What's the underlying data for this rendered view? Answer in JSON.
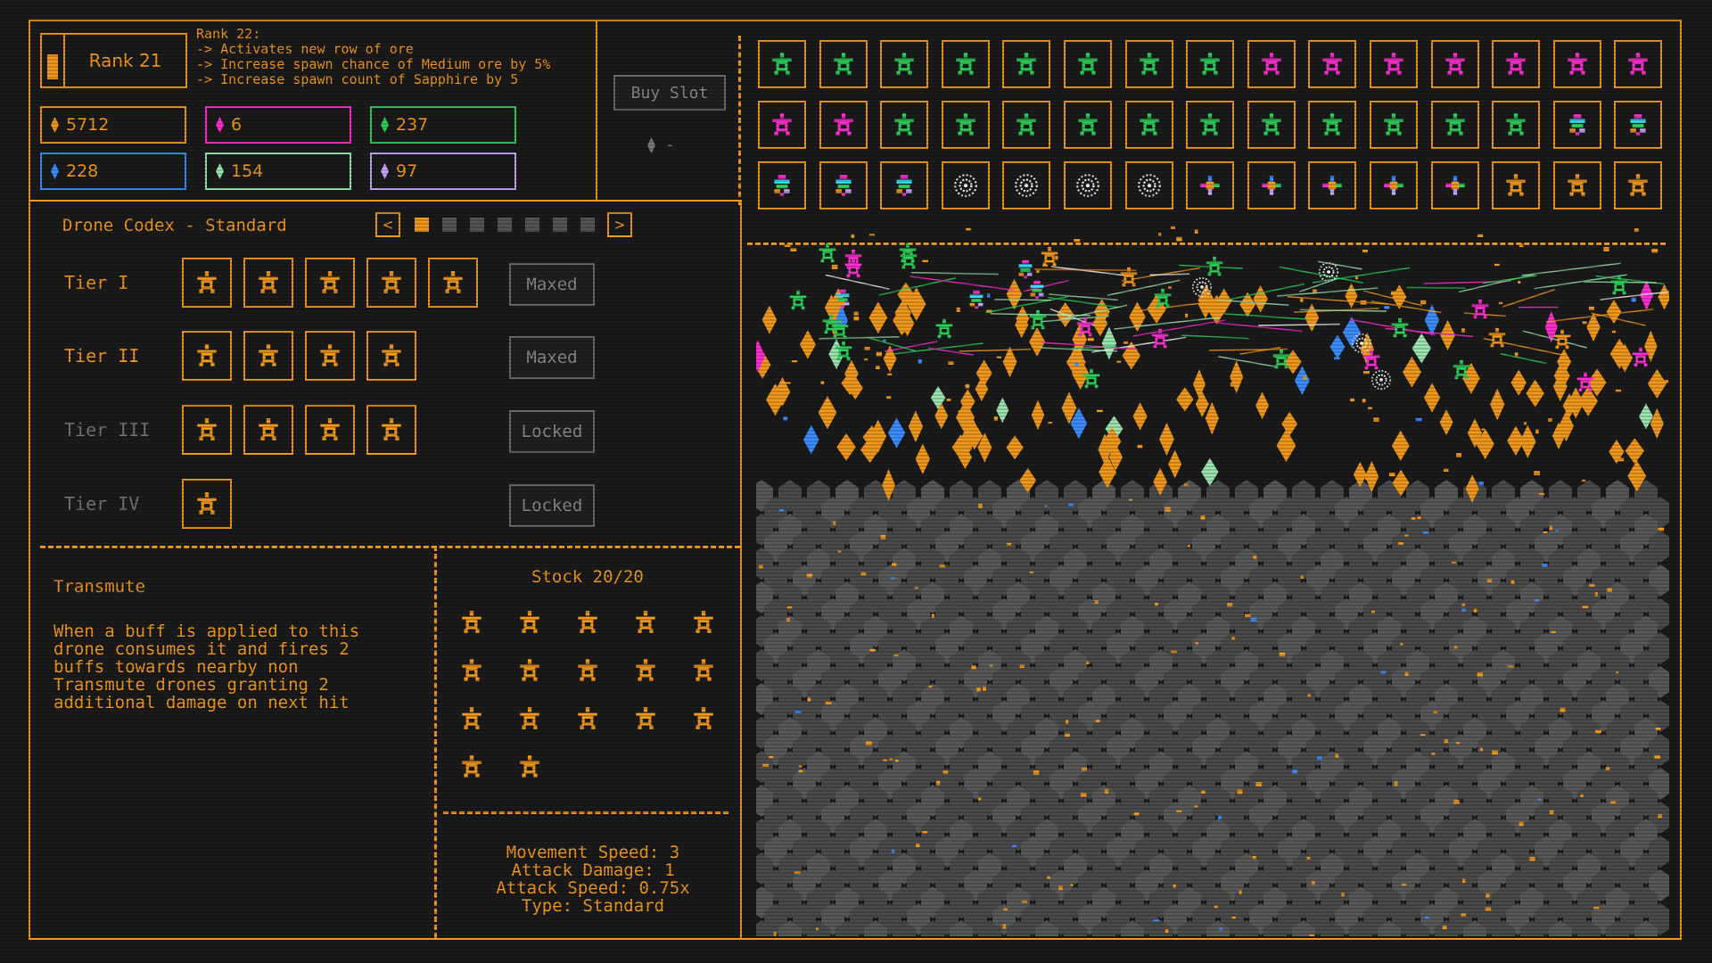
{
  "colors": {
    "accent": "#f39a1e",
    "green": "#2fd05a",
    "magenta": "#ff2fd2",
    "lavender": "#c9a7ff",
    "blue": "#3c8dff",
    "mint": "#9de6b0",
    "gray_ore": "#4a4a4a"
  },
  "rank": {
    "label": "Rank 21",
    "next_info": "Rank 22:\n-> Activates new row of ore\n-> Increase spawn chance of Medium ore by 5%\n-> Increase spawn count of Sapphire by 5"
  },
  "resources": [
    {
      "value": "5712",
      "color": "#f39a1e"
    },
    {
      "value": "6",
      "color": "#ff2fd2"
    },
    {
      "value": "237",
      "color": "#2fd05a"
    },
    {
      "value": "228",
      "color": "#3c8dff"
    },
    {
      "value": "154",
      "color": "#9de6b0"
    },
    {
      "value": "97",
      "color": "#c9a7ff"
    }
  ],
  "shop": {
    "buy_slot_label": "Buy Slot",
    "slot_cost": "-"
  },
  "drone_slots": {
    "rows": [
      [
        "green",
        "green",
        "green",
        "green",
        "green",
        "green",
        "green",
        "green",
        "magenta",
        "magenta",
        "magenta",
        "magenta",
        "magenta",
        "magenta",
        "magenta"
      ],
      [
        "magenta",
        "magenta",
        "green",
        "green",
        "green",
        "green",
        "green",
        "green",
        "green",
        "green",
        "green",
        "green",
        "green",
        "multi",
        "multi"
      ],
      [
        "multi",
        "multi",
        "multi",
        "white",
        "white",
        "white",
        "white",
        "cross",
        "cross",
        "cross",
        "cross",
        "cross",
        "orange",
        "orange",
        "orange"
      ]
    ]
  },
  "codex": {
    "title": "Drone Codex - Standard",
    "prev_icon": "<",
    "next_icon": ">",
    "pages": 7,
    "active_page": 0,
    "tiers": [
      {
        "label": "Tier I",
        "slots": 5,
        "status": "Maxed",
        "locked": false
      },
      {
        "label": "Tier II",
        "slots": 4,
        "status": "Maxed",
        "locked": false
      },
      {
        "label": "Tier III",
        "slots": 4,
        "status": "Locked",
        "locked": true
      },
      {
        "label": "Tier IV",
        "slots": 1,
        "status": "Locked",
        "locked": true
      }
    ]
  },
  "detail": {
    "name": "Transmute",
    "description": "When a buff is applied to this\ndrone consumes it and fires 2\nbuffs towards nearby non\nTransmute drones granting 2\nadditional damage on next hit",
    "stock": "Stock 20/20",
    "stock_count": 17,
    "stats": [
      "Movement Speed: 3",
      "Attack Damage: 1",
      "Attack Speed: 0.75x",
      "Type: Standard"
    ]
  }
}
